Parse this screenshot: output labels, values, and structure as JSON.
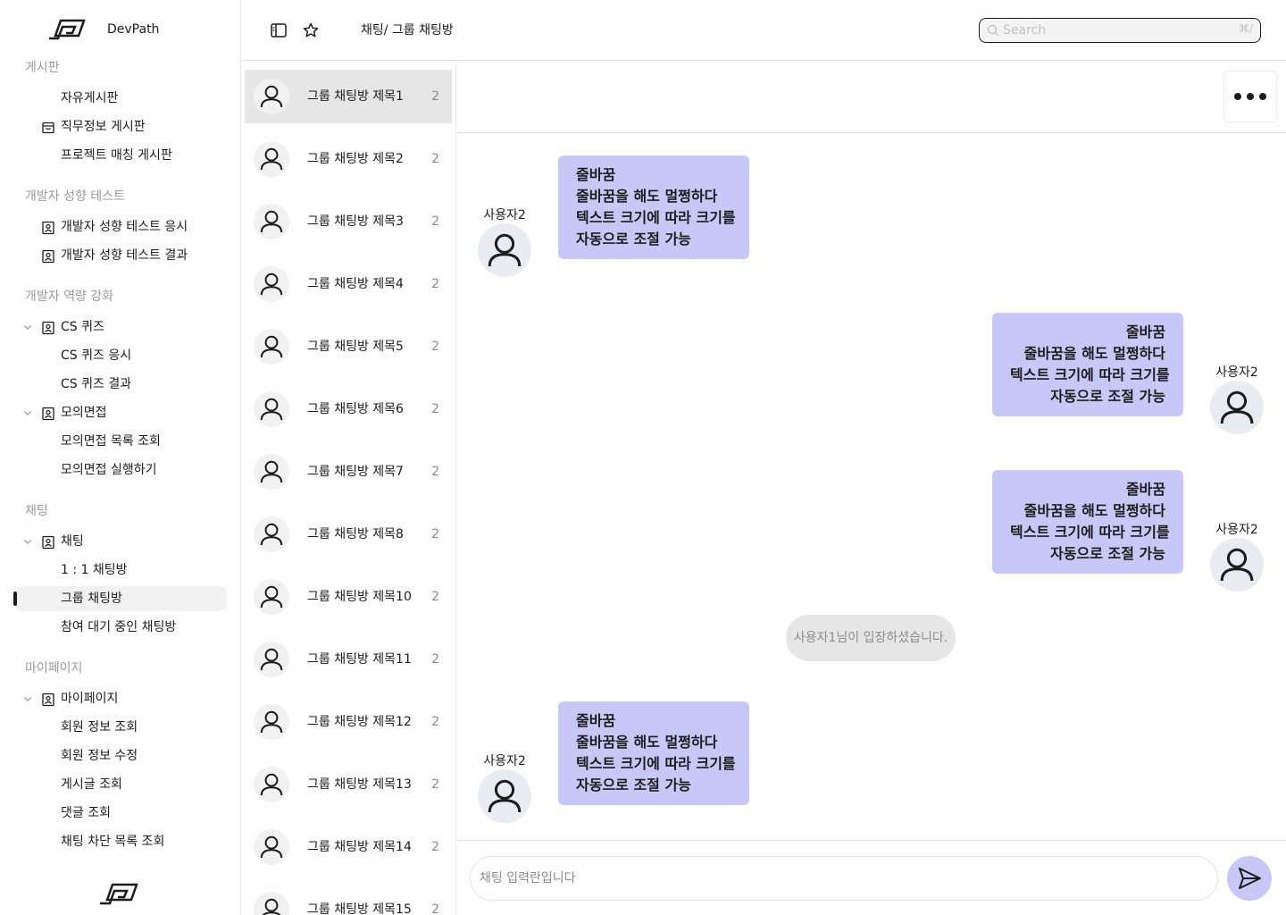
{
  "app": {
    "name": "DevPath"
  },
  "sidebar": {
    "sections": [
      {
        "title": "게시판",
        "items": [
          {
            "label": "자유게시판",
            "icon": "none"
          },
          {
            "label": "직무정보 게시판",
            "icon": "inbox-icon"
          },
          {
            "label": "프로젝트 매칭 게시판",
            "icon": "none"
          }
        ]
      },
      {
        "title": "개발자 성향 테스트",
        "items": [
          {
            "label": "개발자 성향 테스트 응시",
            "icon": "badge-icon"
          },
          {
            "label": "개발자 성향 테스트 결과",
            "icon": "badge-icon"
          }
        ]
      },
      {
        "title": "개발자 역량 강화",
        "items": [
          {
            "label": "CS 퀴즈",
            "icon": "badge-icon",
            "expanded": true
          },
          {
            "label": "CS 퀴즈 응시",
            "icon": "none"
          },
          {
            "label": "CS 퀴즈 결과",
            "icon": "none"
          },
          {
            "label": "모의면접",
            "icon": "badge-icon",
            "expanded": true
          },
          {
            "label": "모의면접 목록 조회",
            "icon": "none"
          },
          {
            "label": "모의면접 실행하기",
            "icon": "none"
          }
        ]
      },
      {
        "title": "채팅",
        "items": [
          {
            "label": "채팅",
            "icon": "badge-icon",
            "expanded": true
          },
          {
            "label": "1 : 1 채팅방",
            "icon": "none"
          },
          {
            "label": "그룹 채팅방",
            "icon": "none",
            "active": true
          },
          {
            "label": "참여 대기 중인 채팅방",
            "icon": "none"
          }
        ]
      },
      {
        "title": "마이페이지",
        "items": [
          {
            "label": "마이페이지",
            "icon": "badge-icon",
            "expanded": true
          },
          {
            "label": "회원 정보 조회",
            "icon": "none"
          },
          {
            "label": "회원 정보 수정",
            "icon": "none"
          },
          {
            "label": "게시글 조회",
            "icon": "none"
          },
          {
            "label": "댓글 조회",
            "icon": "none"
          },
          {
            "label": "채팅 차단 목록 조회",
            "icon": "none"
          }
        ]
      }
    ]
  },
  "header": {
    "breadcrumb": "채팅/ 그룹 채팅방",
    "search_placeholder": "Search",
    "search_shortcut": "⌘/"
  },
  "rooms": [
    {
      "name": "그룹 채팅방 제목1",
      "count": "2",
      "selected": true
    },
    {
      "name": "그룹 채팅방 제목2",
      "count": "2"
    },
    {
      "name": "그룹 채팅방 제목3",
      "count": "2"
    },
    {
      "name": "그룹 채팅방 제목4",
      "count": "2"
    },
    {
      "name": "그룹 채팅방 제목5",
      "count": "2"
    },
    {
      "name": "그룹 채팅방 제목6",
      "count": "2"
    },
    {
      "name": "그룹 채팅방 제목7",
      "count": "2"
    },
    {
      "name": "그룹 채팅방 제목8",
      "count": "2"
    },
    {
      "name": "그룹 채팅방 제목10",
      "count": "2"
    },
    {
      "name": "그룹 채팅방 제목11",
      "count": "2"
    },
    {
      "name": "그룹 채팅방 제목12",
      "count": "2"
    },
    {
      "name": "그룹 채팅방 제목13",
      "count": "2"
    },
    {
      "name": "그룹 채팅방 제목14",
      "count": "2"
    },
    {
      "name": "그룹 채팅방 제목15",
      "count": "2"
    }
  ],
  "messages": [
    {
      "sender": "사용자2",
      "side": "left",
      "lines": [
        "줄바꿈",
        "줄바꿈을 해도 멀쩡하다",
        "텍스트 크기에 따라 크기를",
        "자동으로 조절 가능"
      ]
    },
    {
      "sender": "사용자2",
      "side": "right",
      "lines": [
        "줄바꿈",
        "줄바꿈을 해도 멀쩡하다",
        "텍스트 크기에 따라 크기를",
        "자동으로 조절 가능"
      ]
    },
    {
      "sender": "사용자2",
      "side": "right",
      "lines": [
        "줄바꿈",
        "줄바꿈을 해도 멀쩡하다",
        "텍스트 크기에 따라 크기를",
        "자동으로 조절 가능"
      ]
    },
    {
      "sender": "사용자2",
      "side": "left",
      "lines": [
        "줄바꿈",
        "줄바꿈을 해도 멀쩡하다",
        "텍스트 크기에 따라 크기를",
        "자동으로 조절 가능"
      ]
    }
  ],
  "system_message": "사용자1님이 입장하셨습니다.",
  "chat_input": {
    "placeholder": "채팅 입력란입니다"
  },
  "colors": {
    "bubble": "#c8c8f8",
    "selected_room": "#e6e6e6",
    "active_nav": "#f2f2f2"
  }
}
